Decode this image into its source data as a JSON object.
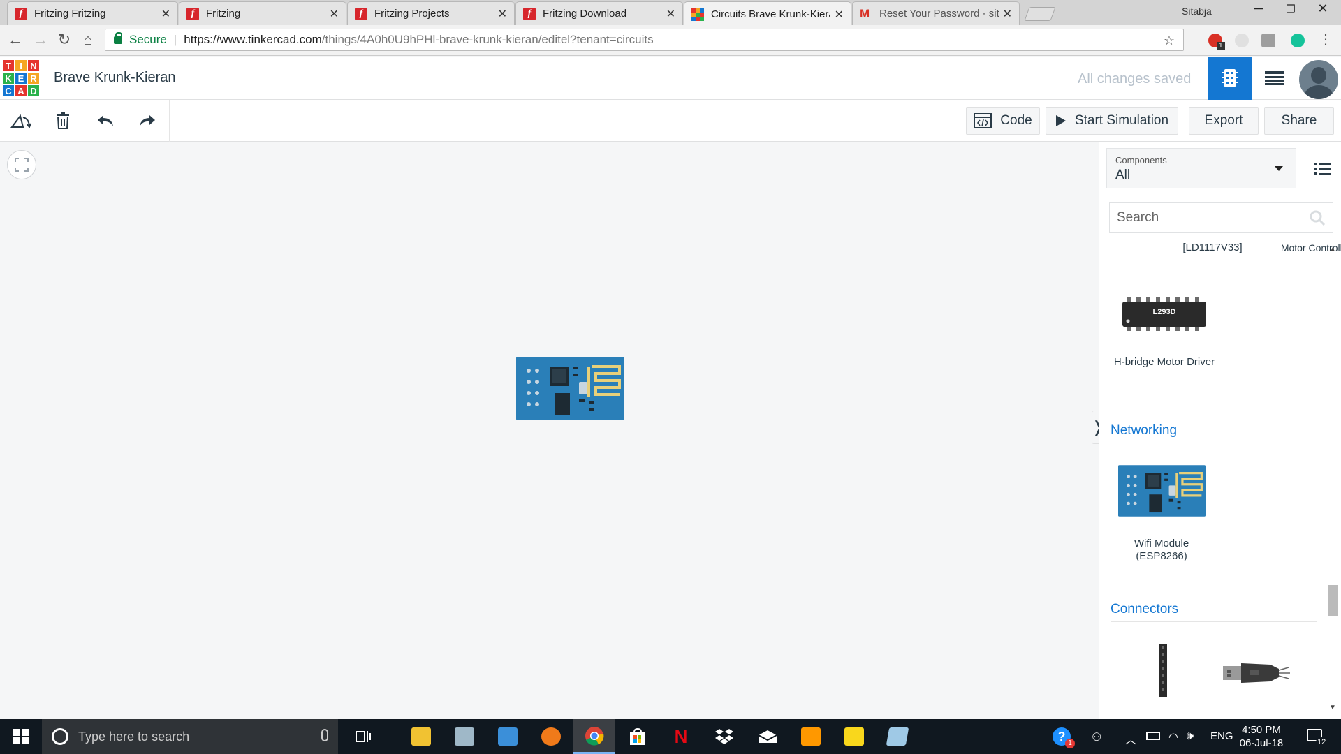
{
  "browser": {
    "tabs": [
      {
        "title": "Fritzing Fritzing",
        "icon": "fritzing-icon",
        "active": false
      },
      {
        "title": "Fritzing",
        "icon": "fritzing-icon",
        "active": false
      },
      {
        "title": "Fritzing Projects",
        "icon": "fritzing-icon",
        "active": false
      },
      {
        "title": "Fritzing Download",
        "icon": "fritzing-icon",
        "active": false
      },
      {
        "title": "Circuits Brave Krunk-Kiera",
        "icon": "tinkercad-icon",
        "active": true
      },
      {
        "title": "Reset Your Password - sit",
        "icon": "gmail-icon",
        "active": false
      }
    ],
    "user": "Sitabja",
    "secure_label": "Secure",
    "url_host": "https://www.tinkercad.com",
    "url_path": "/things/4A0h0U9hPHl-brave-krunk-kieran/editel?tenant=circuits",
    "extension_badge": "1"
  },
  "app": {
    "logo_letters": [
      "T",
      "I",
      "N",
      "K",
      "E",
      "R",
      "C",
      "A",
      "D"
    ],
    "design_name": "Brave Krunk-Kieran",
    "save_status": "All changes saved"
  },
  "toolbar": {
    "code_label": "Code",
    "start_simulation_label": "Start Simulation",
    "export_label": "Export",
    "share_label": "Share"
  },
  "panel": {
    "components_label": "Components",
    "components_value": "All",
    "search_placeholder": "Search",
    "partial_labels": [
      "[LD1117V33]",
      "Motor Controller"
    ],
    "hbridge_chip_text": "L293D",
    "hbridge_label": "H-bridge Motor Driver",
    "networking_heading": "Networking",
    "wifi_label": "Wifi Module (ESP8266)",
    "connectors_heading": "Connectors"
  },
  "taskbar": {
    "search_placeholder": "Type here to search",
    "help_badge": "1",
    "language": "ENG",
    "time": "4:50 PM",
    "date": "06-Jul-18",
    "notification_count": "12"
  },
  "colors": {
    "tinkercad_blue": "#1477d2",
    "esp_board": "#2a7fb8",
    "taskbar": "#101820"
  }
}
